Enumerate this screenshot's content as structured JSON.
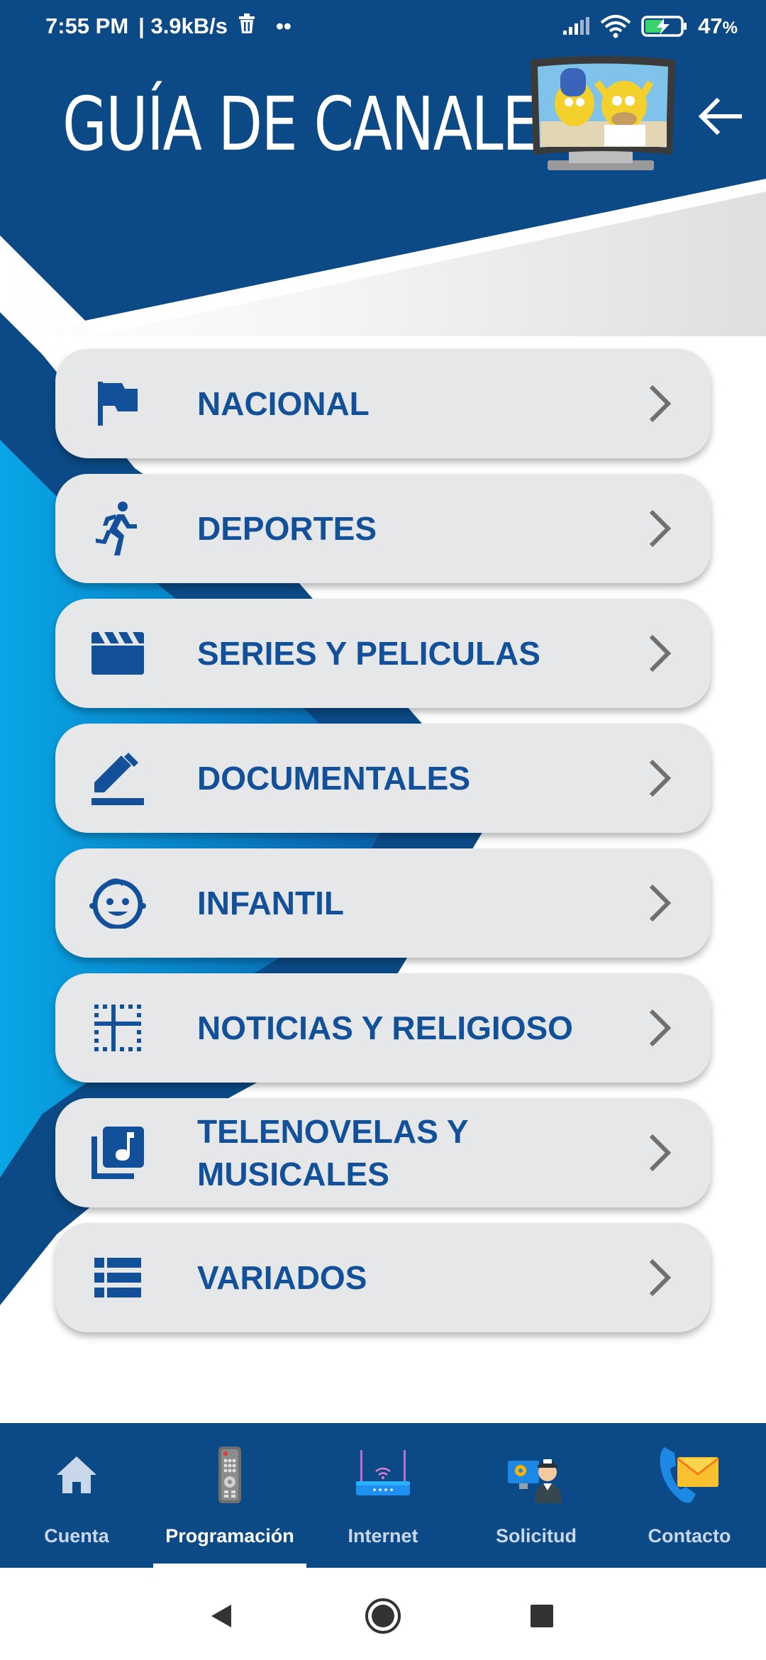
{
  "status_bar": {
    "time": "7:55 PM",
    "speed": "| 3.9kB/s",
    "dots": "••",
    "battery": "47",
    "battery_unit": "%"
  },
  "header": {
    "title": "GUÍA DE CANALES",
    "back_icon": "arrow-left-icon",
    "logo_icon": "tv-cartoon-logo"
  },
  "menu": {
    "items": [
      {
        "label": "NACIONAL",
        "icon": "flag-icon"
      },
      {
        "label": "DEPORTES",
        "icon": "running-person-icon"
      },
      {
        "label": "SERIES Y PELICULAS",
        "icon": "clapperboard-icon"
      },
      {
        "label": "DOCUMENTALES",
        "icon": "pencil-icon"
      },
      {
        "label": "INFANTIL",
        "icon": "child-face-icon"
      },
      {
        "label": "NOTICIAS Y RELIGIOSO",
        "icon": "border-grid-icon"
      },
      {
        "label": "TELENOVELAS Y\nMUSICALES",
        "icon": "music-library-icon"
      },
      {
        "label": "VARIADOS",
        "icon": "list-icon"
      }
    ]
  },
  "bottom_nav": {
    "items": [
      {
        "label": "Cuenta",
        "icon": "home-icon"
      },
      {
        "label": "Programación",
        "icon": "remote-control-icon",
        "active": true
      },
      {
        "label": "Internet",
        "icon": "router-icon"
      },
      {
        "label": "Solicitud",
        "icon": "technician-icon"
      },
      {
        "label": "Contacto",
        "icon": "phone-envelope-icon"
      }
    ]
  },
  "colors": {
    "primary": "#0b4a86",
    "accent_text": "#12509a",
    "card_bg": "#e6e7e9",
    "chevron": "#707070"
  }
}
